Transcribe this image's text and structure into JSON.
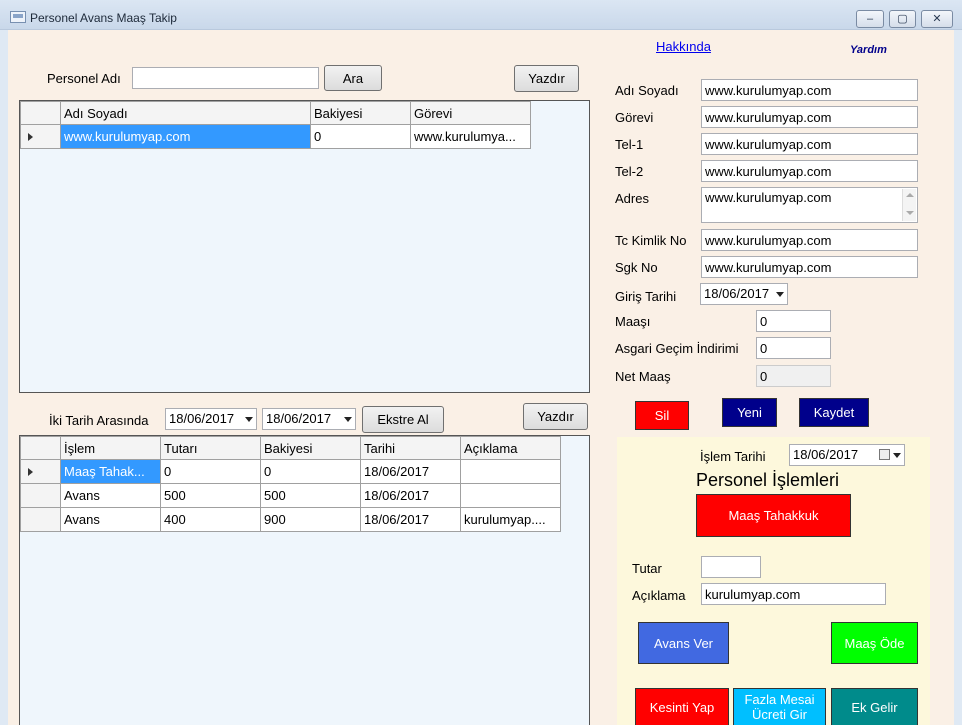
{
  "window": {
    "title": "Personel Avans Maaş Takip",
    "minimize": "–",
    "maximize": "▢",
    "close": "✕"
  },
  "top_links": {
    "about": "Hakkında",
    "help": "Yardım"
  },
  "search": {
    "label": "Personel Adı",
    "value": "",
    "search_button": "Ara",
    "print_button": "Yazdır"
  },
  "personel_grid": {
    "columns": [
      "Adı Soyadı",
      "Bakiyesi",
      "Görevi"
    ],
    "rows": [
      {
        "name": "www.kurulumyap.com",
        "balance": "0",
        "role": "www.kurulumya..."
      }
    ]
  },
  "date_filter": {
    "label": "İki Tarih Arasında",
    "from": "18/06/2017",
    "to": "18/06/2017",
    "extract_button": "Ekstre Al",
    "print_button": "Yazdır"
  },
  "transactions_grid": {
    "columns": [
      "İşlem",
      "Tutarı",
      "Bakiyesi",
      "Tarihi",
      "Açıklama"
    ],
    "rows": [
      {
        "type": "Maaş Tahak...",
        "amount": "0",
        "balance": "0",
        "date": "18/06/2017",
        "note": ""
      },
      {
        "type": "Avans",
        "amount": "500",
        "balance": "500",
        "date": "18/06/2017",
        "note": ""
      },
      {
        "type": "Avans",
        "amount": "400",
        "balance": "900",
        "date": "18/06/2017",
        "note": "kurulumyap...."
      }
    ]
  },
  "details": {
    "name_label": "Adı Soyadı",
    "name_value": "www.kurulumyap.com",
    "role_label": "Görevi",
    "role_value": "www.kurulumyap.com",
    "tel1_label": "Tel-1",
    "tel1_value": "www.kurulumyap.com",
    "tel2_label": "Tel-2",
    "tel2_value": "www.kurulumyap.com",
    "address_label": "Adres",
    "address_value": "www.kurulumyap.com",
    "tc_label": "Tc Kimlik No",
    "tc_value": "www.kurulumyap.com",
    "sgk_label": "Sgk No",
    "sgk_value": "www.kurulumyap.com",
    "start_date_label": "Giriş Tarihi",
    "start_date_value": "18/06/2017",
    "salary_label": "Maaşı",
    "salary_value": "0",
    "agi_label": "Asgari Geçim İndirimi",
    "agi_value": "0",
    "net_label": "Net Maaş",
    "net_value": "0"
  },
  "actions": {
    "delete": "Sil",
    "new": "Yeni",
    "save": "Kaydet"
  },
  "operations": {
    "date_label": "İşlem Tarihi",
    "date_value": "18/06/2017",
    "title": "Personel İşlemleri",
    "salary_accrual": "Maaş Tahakkuk",
    "amount_label": "Tutar",
    "amount_value": "",
    "note_label": "Açıklama",
    "note_value": "kurulumyap.com",
    "advance": "Avans Ver",
    "pay_salary": "Maaş Öde",
    "deduction": "Kesinti Yap",
    "overtime": "Fazla Mesai Ücreti Gir",
    "extra_income": "Ek Gelir"
  },
  "colors": {
    "red": "#ff0000",
    "navy": "#00008b",
    "royal_blue": "#4169e1",
    "green": "#00ff00",
    "cyan": "#00bfff",
    "teal": "#008b8b",
    "grid_bg": "#eff6fc",
    "form_bg": "#faf0e6",
    "panel_bg": "#fdf8dc"
  }
}
